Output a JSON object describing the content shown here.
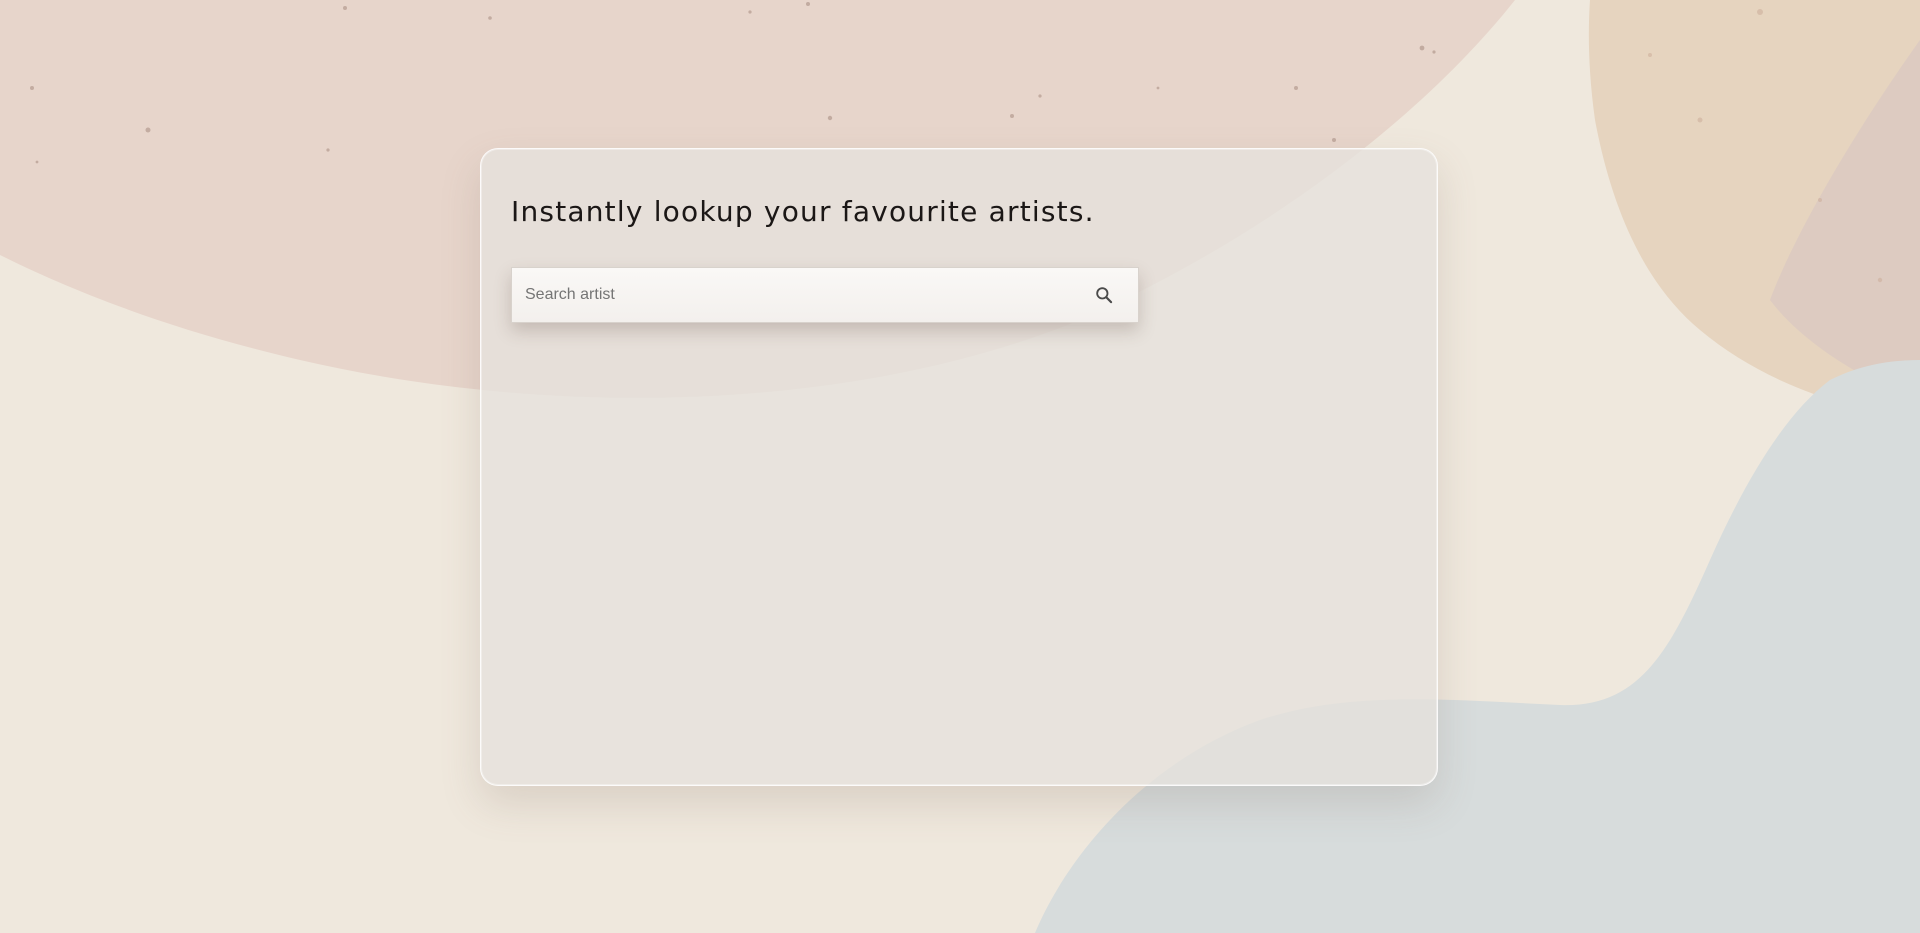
{
  "header": {
    "title": "Instantly lookup your favourite artists."
  },
  "search": {
    "placeholder": "Search artist",
    "value": "",
    "icon": "search-icon"
  },
  "colors": {
    "background": "#efe8dd",
    "blob_pink": "#e7d5cb",
    "blob_tan": "#e6d4bf",
    "blob_blue": "#d7dcdc",
    "title_text": "#1b1716",
    "card": "#e6e2dc"
  }
}
